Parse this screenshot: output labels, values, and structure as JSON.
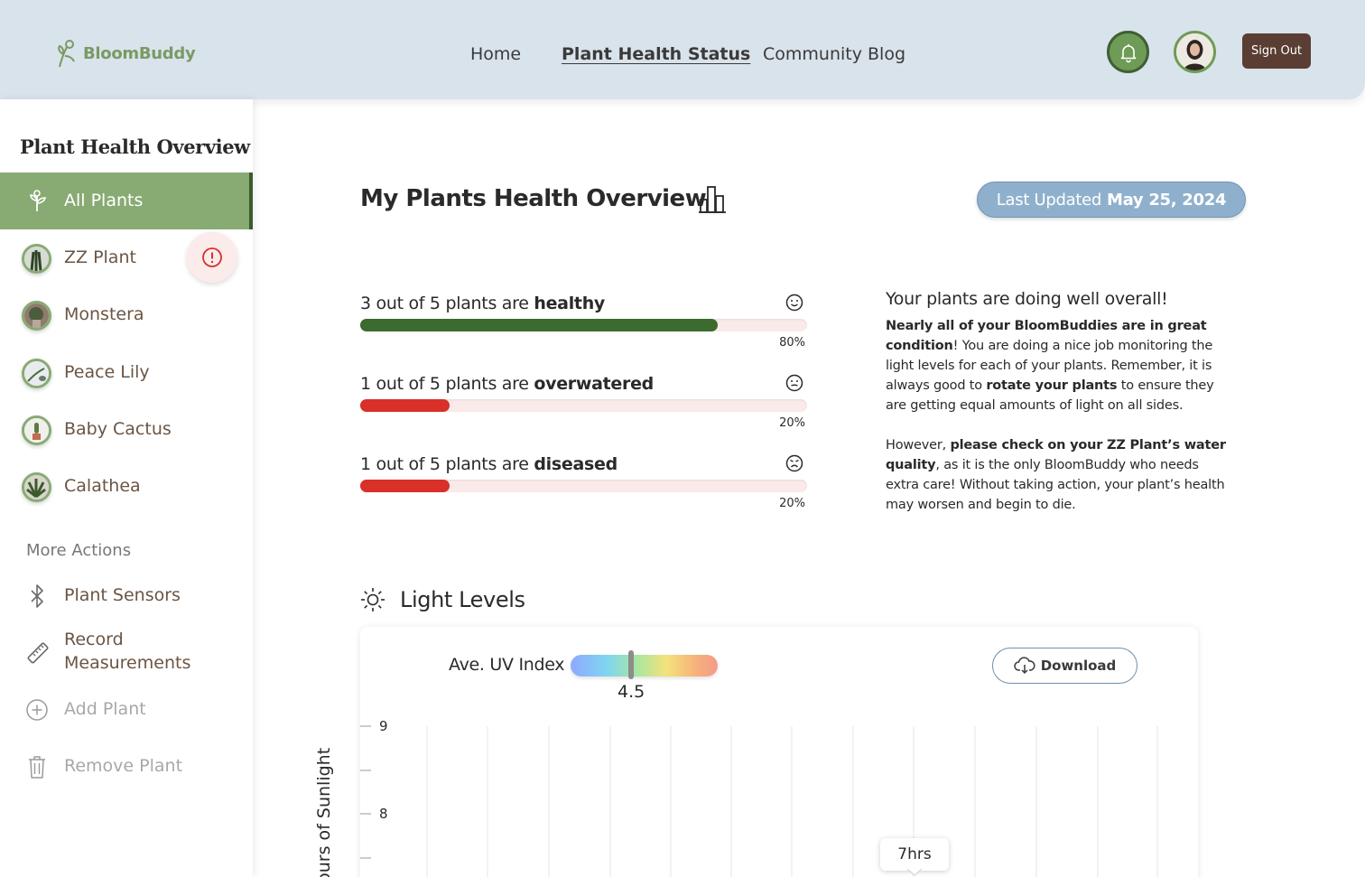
{
  "header": {
    "logo_text": "BloomBuddy",
    "nav": [
      {
        "label": "Home"
      },
      {
        "label": "Plant Health Status",
        "active": true
      },
      {
        "label": "Community Blog"
      }
    ],
    "signout_label": "Sign Out",
    "bell_color": "#6e9b55",
    "brand_color": "#7a9a63"
  },
  "sidebar": {
    "title": "Plant Health Overview",
    "all_plants_label": "All Plants",
    "plants": [
      {
        "label": "ZZ Plant",
        "alert": true,
        "icon": "zz-plant-thumbnail"
      },
      {
        "label": "Monstera",
        "icon": "monstera-thumbnail"
      },
      {
        "label": "Peace Lily",
        "icon": "peace-lily-thumbnail"
      },
      {
        "label": "Baby Cactus",
        "icon": "baby-cactus-thumbnail"
      },
      {
        "label": "Calathea",
        "icon": "calathea-thumbnail"
      }
    ],
    "more_actions_label": "More Actions",
    "actions": [
      {
        "label": "Plant Sensors",
        "icon": "bluetooth-icon"
      },
      {
        "label": "Record Measurements",
        "icon": "ruler-icon"
      },
      {
        "label": "Add Plant",
        "icon": "plus-circle-icon"
      },
      {
        "label": "Remove Plant",
        "icon": "trash-icon"
      }
    ],
    "accent_color": "#88aa73"
  },
  "main": {
    "title": "My Plants Health Overview",
    "updated_prefix": "Last Updated",
    "updated_date": "May 25, 2024",
    "stats": [
      {
        "prefix": "3 out of 5 plants are",
        "status": "healthy",
        "percent": 80,
        "percent_label": "80%",
        "color": "#3d6a2e",
        "face": "smile"
      },
      {
        "prefix": "1 out of 5 plants are",
        "status": "overwatered",
        "percent": 20,
        "percent_label": "20%",
        "color": "#d9302a",
        "face": "neutral"
      },
      {
        "prefix": "1 out of 5 plants are",
        "status": "diseased",
        "percent": 20,
        "percent_label": "20%",
        "color": "#d9302a",
        "face": "sad"
      }
    ],
    "summary": {
      "heading": "Your plants are doing well overall!",
      "p1_bold": "Nearly all of your BloomBuddies are in great condition",
      "p1_mid": "! You are doing a nice job monitoring the light levels for each of your plants. Remember, it is always good to ",
      "p1_bold2": "rotate your plants",
      "p1_end": " to ensure they are getting equal amounts of light on all sides.",
      "p2_start": "However, ",
      "p2_bold": "please check on your ZZ Plant’s water quality",
      "p2_end": ", as it is the only BloomBuddy who needs extra care! Without taking action, your plant’s health may worsen and begin to die."
    },
    "light": {
      "title": "Light Levels",
      "uv_label": "Ave. UV Index",
      "uv_value": "4.5",
      "download_label": "Download",
      "tooltip": "7hrs"
    }
  },
  "chart_data": {
    "type": "bar",
    "ylabel": "Hours of Sunlight",
    "yticks": [
      "9",
      "8"
    ],
    "grid": true,
    "annotation": "7hrs"
  }
}
